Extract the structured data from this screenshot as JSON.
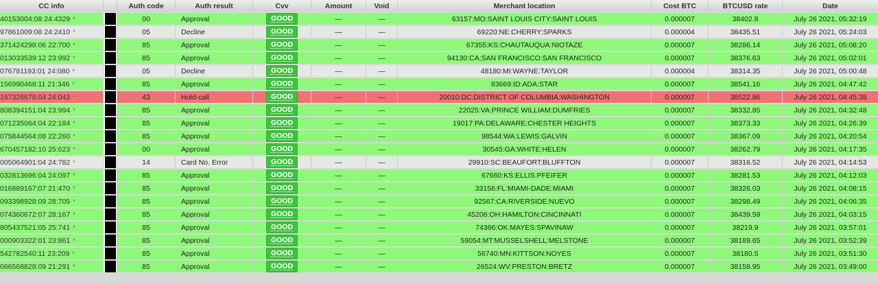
{
  "columns": {
    "cc_info": "CC info",
    "bin": "",
    "auth_code": "Auth code",
    "auth_result": "Auth result",
    "cvv": "Cvv",
    "amount": "Amount",
    "void": "Void",
    "merchant_location": "Merchant location",
    "cost_btc": "Cost BTC",
    "btcusd_rate": "BTCUSD rate",
    "date": "Date"
  },
  "colors": {
    "approval_row": "#8ff87a",
    "decline_row": "#e6e8e6",
    "hold_row": "#ef7373",
    "good_badge": "#3ec33e"
  },
  "rows": [
    {
      "status": "approval",
      "cc": "40153004:08 24:4329",
      "star": "*",
      "auth_code": "00",
      "auth_result": "Approval",
      "cvv": "GOOD",
      "amount": "—",
      "void": "—",
      "merchant": "63157:MO:SAINT LOUIS CITY:SAINT LOUIS",
      "cost": "0.000007",
      "rate": "38402.8",
      "date": "July 26 2021, 05:32:19"
    },
    {
      "status": "decline",
      "cc": "97861009:08 24:2410",
      "star": "*",
      "auth_code": "05",
      "auth_result": "Decline",
      "cvv": "GOOD",
      "amount": "—",
      "void": "—",
      "merchant": "69220:NE:CHERRY:SPARKS",
      "cost": "0.000004",
      "rate": "38435.51",
      "date": "July 26 2021, 05:24:03"
    },
    {
      "status": "approval",
      "cc": "371424298:06 22:700",
      "star": "*",
      "auth_code": "85",
      "auth_result": "Approval",
      "cvv": "GOOD",
      "amount": "—",
      "void": "—",
      "merchant": "67355:KS:CHAUTAUQUA:NIOTAZE",
      "cost": "0.000007",
      "rate": "38286.14",
      "date": "July 26 2021, 05:08:20"
    },
    {
      "status": "approval",
      "cc": "013033539:12 23:992",
      "star": "*",
      "auth_code": "85",
      "auth_result": "Approval",
      "cvv": "GOOD",
      "amount": "—",
      "void": "—",
      "merchant": "94130:CA:SAN FRANCISCO:SAN FRANCISCO",
      "cost": "0.000007",
      "rate": "38376.63",
      "date": "July 26 2021, 05:02:01"
    },
    {
      "status": "decline",
      "cc": "076781193:01 24:080",
      "star": "*",
      "auth_code": "05",
      "auth_result": "Decline",
      "cvv": "GOOD",
      "amount": "—",
      "void": "—",
      "merchant": "48180:MI:WAYNE:TAYLOR",
      "cost": "0.000004",
      "rate": "38314.35",
      "date": "July 26 2021, 05:00:48"
    },
    {
      "status": "approval",
      "cc": "156990468:11 21:346",
      "star": "*",
      "auth_code": "85",
      "auth_result": "Approval",
      "cvv": "GOOD",
      "amount": "—",
      "void": "—",
      "merchant": "83669:ID:ADA:STAR",
      "cost": "0.000007",
      "rate": "38541.16",
      "date": "July 26 2021, 04:47:42"
    },
    {
      "status": "hold",
      "cc": "167326678:04 24:043",
      "star": "*",
      "auth_code": "43",
      "auth_result": "Hold-call",
      "cvv": "GOOD",
      "amount": "—",
      "void": "—",
      "merchant": "20010:DC:DISTRICT OF COLUMBIA:WASHINGTON",
      "cost": "0.000007",
      "rate": "38522.86",
      "date": "July 26 2021, 04:45:38"
    },
    {
      "status": "approval",
      "cc": "808394151:04 23:994",
      "star": "*",
      "auth_code": "85",
      "auth_result": "Approval",
      "cvv": "GOOD",
      "amount": "—",
      "void": "—",
      "merchant": "22025:VA:PRINCE WILLIAM:DUMFRIES",
      "cost": "0.000007",
      "rate": "38332.85",
      "date": "July 26 2021, 04:32:48"
    },
    {
      "status": "approval",
      "cc": "071235064:04 22:184",
      "star": "*",
      "auth_code": "85",
      "auth_result": "Approval",
      "cvv": "GOOD",
      "amount": "—",
      "void": "—",
      "merchant": "19017:PA:DELAWARE:CHESTER HEIGHTS",
      "cost": "0.000007",
      "rate": "38373.33",
      "date": "July 26 2021, 04:26:39"
    },
    {
      "status": "approval",
      "cc": "075844564:08 22:260",
      "star": "*",
      "auth_code": "85",
      "auth_result": "Approval",
      "cvv": "GOOD",
      "amount": "—",
      "void": "—",
      "merchant": "98544:WA:LEWIS:GALVIN",
      "cost": "0.000007",
      "rate": "38367.09",
      "date": "July 26 2021, 04:20:54"
    },
    {
      "status": "approval",
      "cc": "670457182:10 25:623",
      "star": "*",
      "auth_code": "00",
      "auth_result": "Approval",
      "cvv": "GOOD",
      "amount": "—",
      "void": "—",
      "merchant": "30545:GA:WHITE:HELEN",
      "cost": "0.000007",
      "rate": "38262.79",
      "date": "July 26 2021, 04:17:35"
    },
    {
      "status": "decline",
      "cc": "005064901:04 24:782",
      "star": "*",
      "auth_code": "14",
      "auth_result": "Card No. Error",
      "cvv": "GOOD",
      "amount": "—",
      "void": "—",
      "merchant": "29910:SC:BEAUFORT:BLUFFTON",
      "cost": "0.000007",
      "rate": "38316.52",
      "date": "July 26 2021, 04:14:53"
    },
    {
      "status": "approval",
      "cc": "032813696:04 24:097",
      "star": "*",
      "auth_code": "85",
      "auth_result": "Approval",
      "cvv": "GOOD",
      "amount": "—",
      "void": "—",
      "merchant": "67660:KS:ELLIS:PFEIFER",
      "cost": "0.000007",
      "rate": "38281.53",
      "date": "July 26 2021, 04:12:03"
    },
    {
      "status": "approval",
      "cc": "016889167:07 21:470",
      "star": "*",
      "auth_code": "85",
      "auth_result": "Approval",
      "cvv": "GOOD",
      "amount": "—",
      "void": "—",
      "merchant": "33156:FL:MIAMI-DADE:MIAMI",
      "cost": "0.000007",
      "rate": "38326.03",
      "date": "July 26 2021, 04:08:15"
    },
    {
      "status": "approval",
      "cc": "093398928:09 28:705",
      "star": "*",
      "auth_code": "85",
      "auth_result": "Approval",
      "cvv": "GOOD",
      "amount": "—",
      "void": "—",
      "merchant": "92567:CA:RIVERSIDE:NUEVO",
      "cost": "0.000007",
      "rate": "38298.49",
      "date": "July 26 2021, 04:06:35"
    },
    {
      "status": "approval",
      "cc": "074360672:07 28:167",
      "star": "*",
      "auth_code": "85",
      "auth_result": "Approval",
      "cvv": "GOOD",
      "amount": "—",
      "void": "—",
      "merchant": "45206:OH:HAMILTON:CINCINNATI",
      "cost": "0.000007",
      "rate": "38439.59",
      "date": "July 26 2021, 04:03:15"
    },
    {
      "status": "approval",
      "cc": "805437521:05 25:741",
      "star": "*",
      "auth_code": "85",
      "auth_result": "Approval",
      "cvv": "GOOD",
      "amount": "—",
      "void": "—",
      "merchant": "74366:OK:MAYES:SPAVINAW",
      "cost": "0.000007",
      "rate": "38219.9",
      "date": "July 26 2021, 03:57:01"
    },
    {
      "status": "approval",
      "cc": "000903322:01 23:861",
      "star": "*",
      "auth_code": "85",
      "auth_result": "Approval",
      "cvv": "GOOD",
      "amount": "—",
      "void": "—",
      "merchant": "59054:MT:MUSSELSHELL:MELSTONE",
      "cost": "0.000007",
      "rate": "38189.65",
      "date": "July 26 2021, 03:52:39"
    },
    {
      "status": "approval",
      "cc": "542782540:11 23:209",
      "star": "*",
      "auth_code": "85",
      "auth_result": "Approval",
      "cvv": "GOOD",
      "amount": "—",
      "void": "—",
      "merchant": "56740:MN:KITTSON:NOYES",
      "cost": "0.000007",
      "rate": "38180.5",
      "date": "July 26 2021, 03:51:30"
    },
    {
      "status": "approval",
      "cc": "066568828:09 21:291",
      "star": "*",
      "auth_code": "85",
      "auth_result": "Approval",
      "cvv": "GOOD",
      "amount": "—",
      "void": "—",
      "merchant": "26524:WV:PRESTON:BRETZ",
      "cost": "0.000007",
      "rate": "38158.95",
      "date": "July 26 2021, 03:49:00"
    }
  ]
}
